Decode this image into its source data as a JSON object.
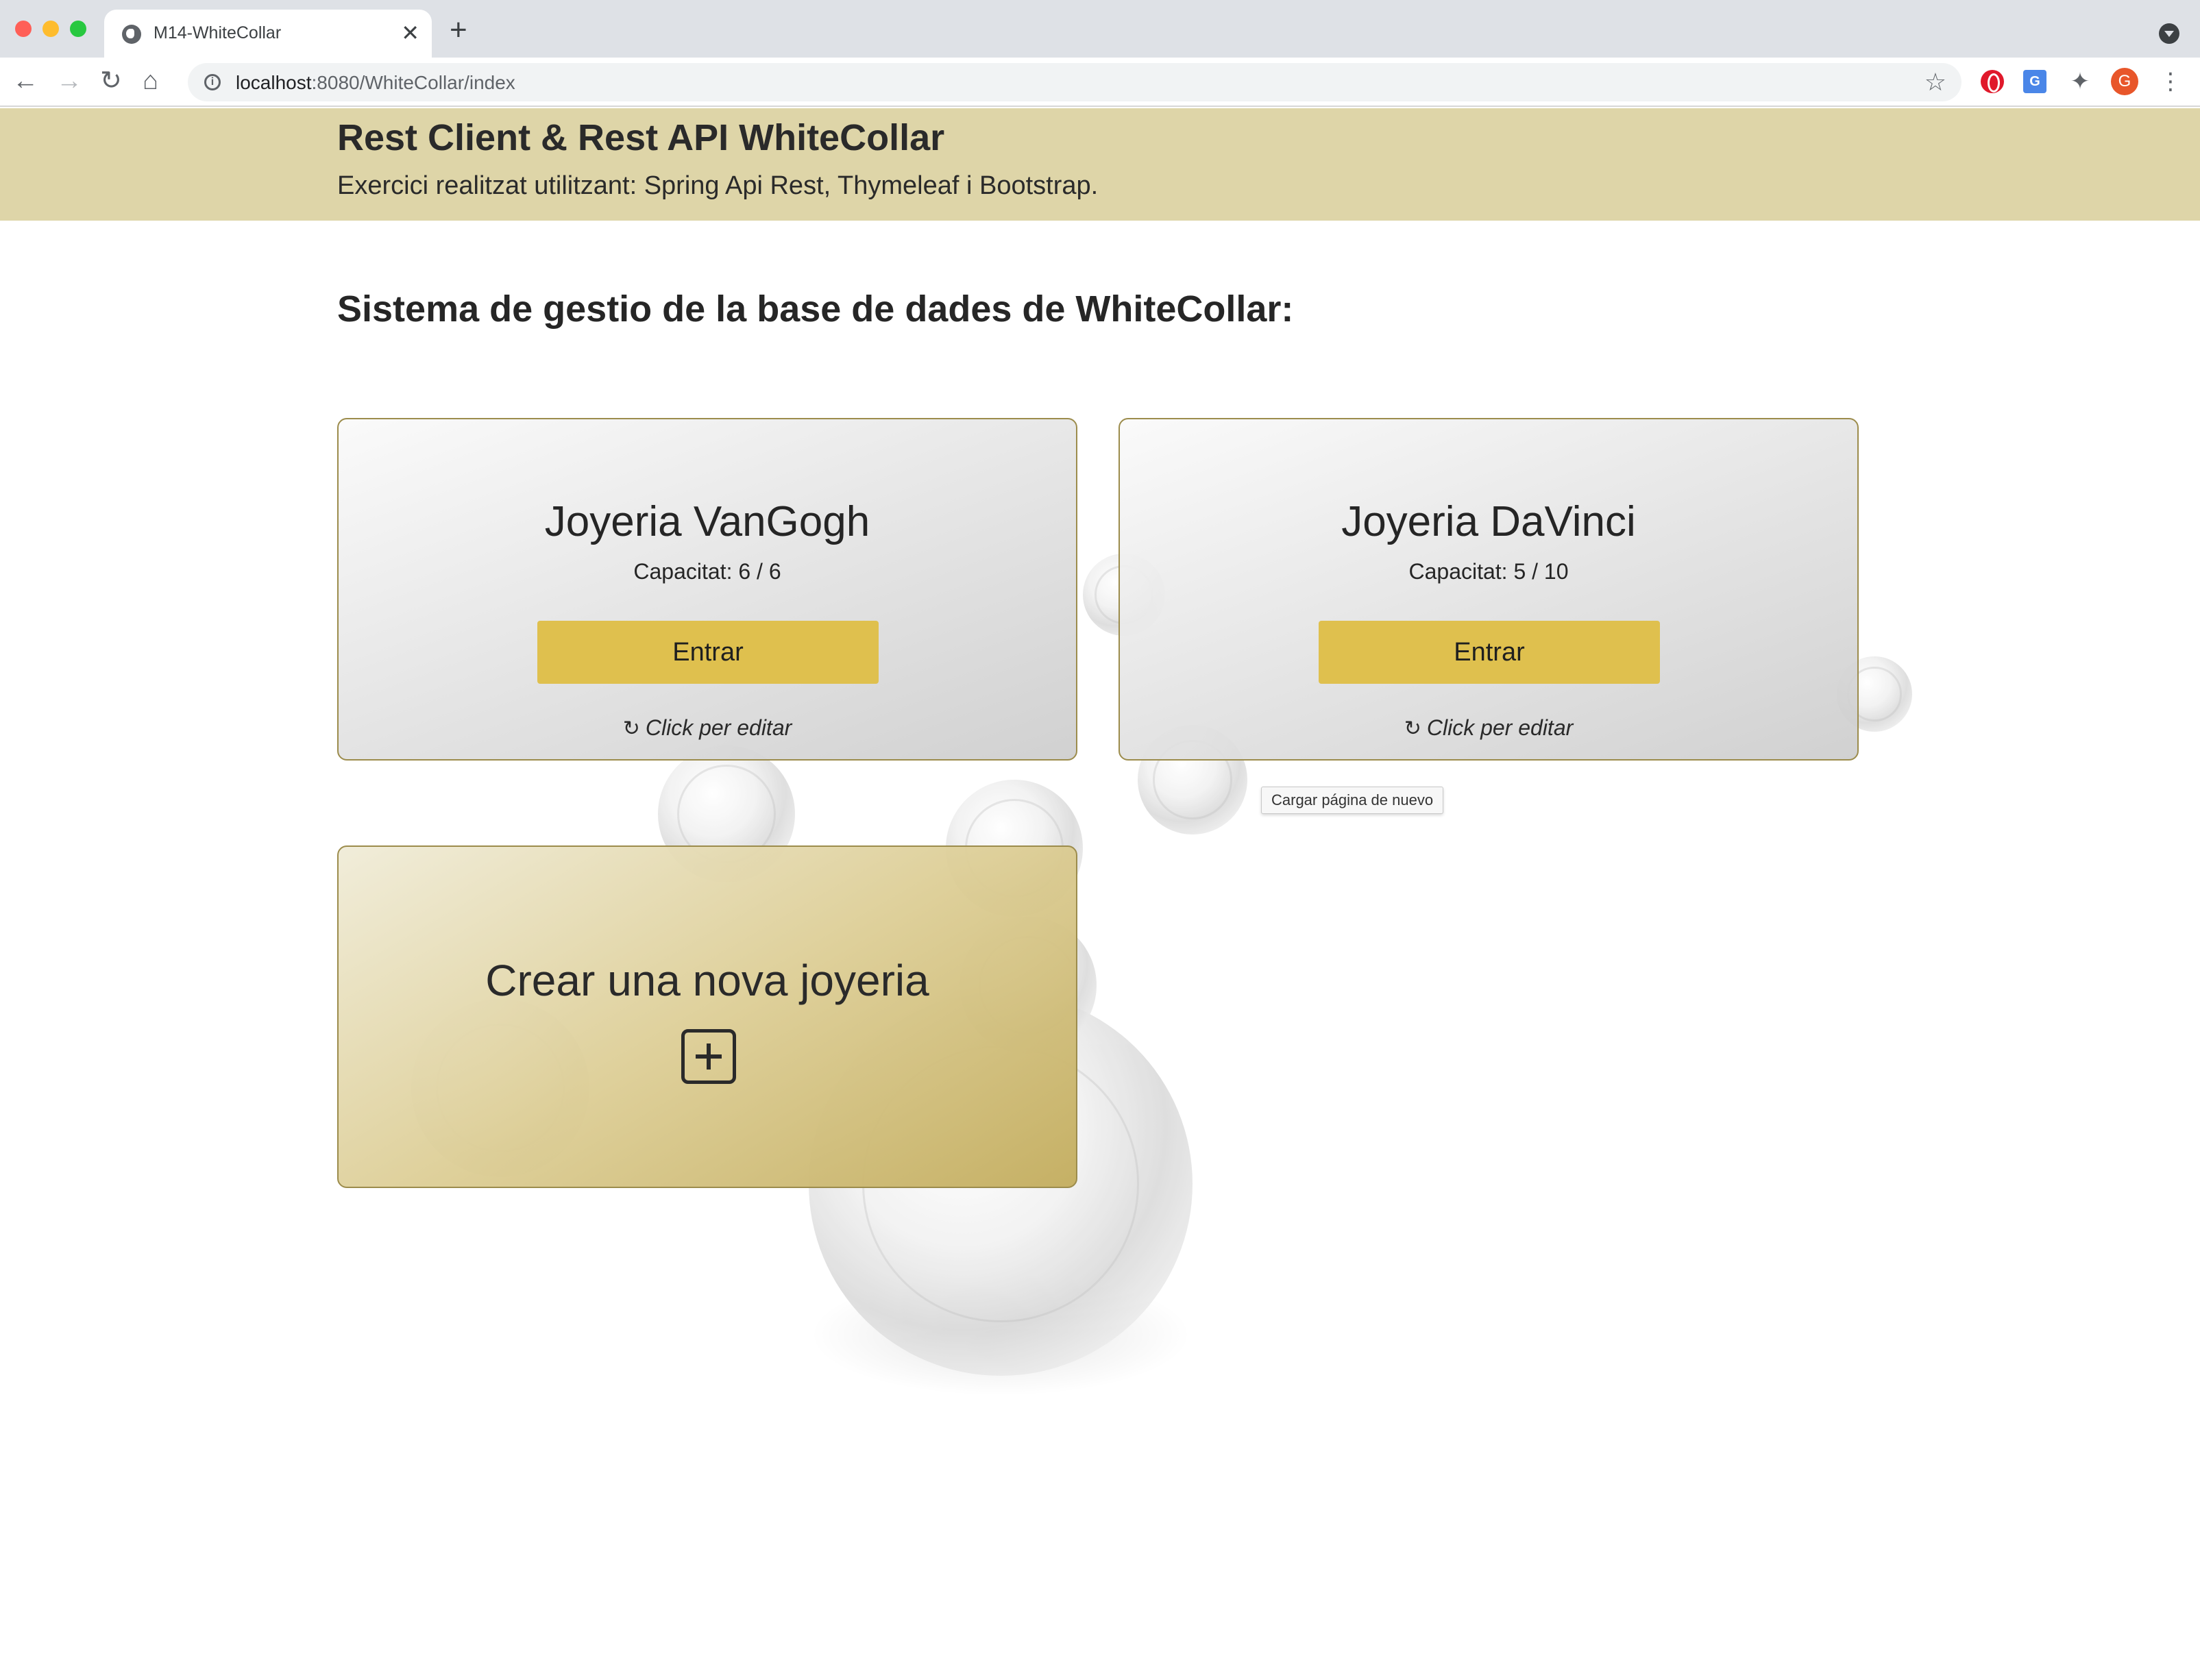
{
  "browser": {
    "tab_title": "M14-WhiteCollar",
    "url_host": "localhost",
    "url_rest": ":8080/WhiteCollar/index",
    "close_glyph": "✕",
    "newtab_glyph": "+",
    "avatar_initial": "G",
    "translate_glyph": "G"
  },
  "header": {
    "title": "Rest Client & Rest API WhiteCollar",
    "subtitle": "Exercici realitzat utilitzant: Spring Api Rest, Thymeleaf i Bootstrap."
  },
  "main": {
    "section_title": "Sistema de gestio de la base de dades de WhiteCollar:",
    "stores": [
      {
        "name": "Joyeria VanGogh",
        "capacity": "Capacitat: 6 / 6",
        "button": "Entrar",
        "edit": "Click per editar"
      },
      {
        "name": "Joyeria DaVinci",
        "capacity": "Capacitat: 5 / 10",
        "button": "Entrar",
        "edit": "Click per editar"
      }
    ],
    "create_card": {
      "title": "Crear una nova joyeria",
      "icon": "plus-square-icon"
    },
    "tooltip": "Cargar página de nuevo"
  },
  "colors": {
    "hero_background": "#ded5a8",
    "button_gold": "#dfc04e",
    "card_border": "#9c8c4c"
  }
}
